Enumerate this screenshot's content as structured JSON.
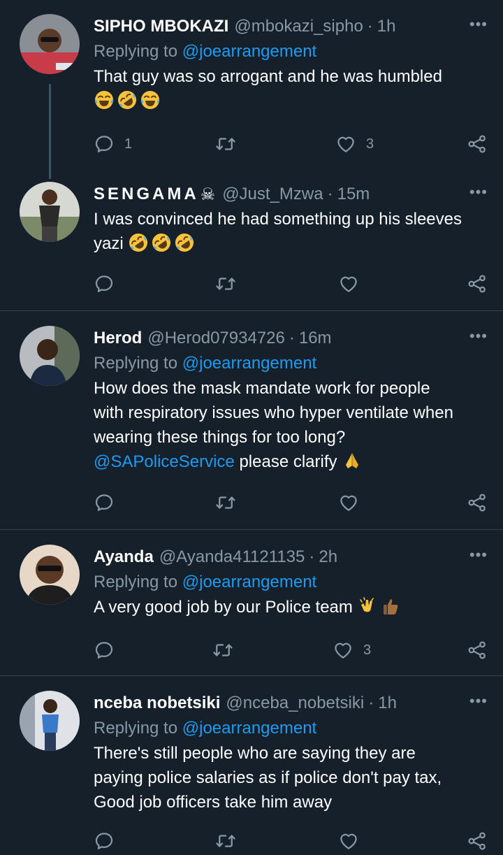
{
  "tweets": [
    {
      "name": "SIPHO MBOKAZI",
      "handle": "@mbokazi_sipho",
      "time": "1h",
      "replying_label": "Replying to",
      "replying_to": "@joearrangement",
      "text": "That guy was so arrogant and he was humbled",
      "emojis": [
        "face-with-tears-of-joy",
        "rolling-on-floor-laughing",
        "face-with-tears-of-joy"
      ],
      "replies": "1",
      "retweets": "",
      "likes": "3"
    },
    {
      "name": "SENGAMA",
      "name_symbol": "☠",
      "handle": "@Just_Mzwa",
      "time": "15m",
      "text_line1": "I was convinced he had something up his sleeves",
      "text_line2": "yazi",
      "emojis": [
        "rolling-on-floor-laughing",
        "rolling-on-floor-laughing",
        "rolling-on-floor-laughing"
      ],
      "replies": "",
      "retweets": "",
      "likes": ""
    },
    {
      "name": "Herod",
      "handle": "@Herod07934726",
      "time": "16m",
      "replying_label": "Replying to",
      "replying_to": "@joearrangement",
      "text_line1": "How does the mask mandate work for people",
      "text_line2": "with respiratory issues who hyper ventilate when",
      "text_line3": "wearing these things for too long?",
      "text_mention": "@SAPoliceService",
      "text_line4_rest": " please clarify",
      "emojis": [
        "folded-hands"
      ],
      "replies": "",
      "retweets": "",
      "likes": ""
    },
    {
      "name": "Ayanda",
      "handle": "@Ayanda41121135",
      "time": "2h",
      "replying_label": "Replying to",
      "replying_to": "@joearrangement",
      "text": "A very good job by our Police team",
      "emojis": [
        "clapping-hands",
        "thumbs-up"
      ],
      "replies": "",
      "retweets": "",
      "likes": "3"
    },
    {
      "name": "nceba nobetsiki",
      "handle": "@nceba_nobetsiki",
      "time": "1h",
      "replying_label": "Replying to",
      "replying_to": "@joearrangement",
      "text_line1": "There's still people who are saying they are",
      "text_line2": "paying police salaries as if police don't pay tax,",
      "text_line3": "Good job officers take him away",
      "replies": "",
      "retweets": "",
      "likes": ""
    }
  ],
  "ui": {
    "separator": "·",
    "more": "•••"
  },
  "colors": {
    "background": "#15202b",
    "secondary_text": "#8899a6",
    "link": "#1d9bf0",
    "divider": "#38444d"
  }
}
